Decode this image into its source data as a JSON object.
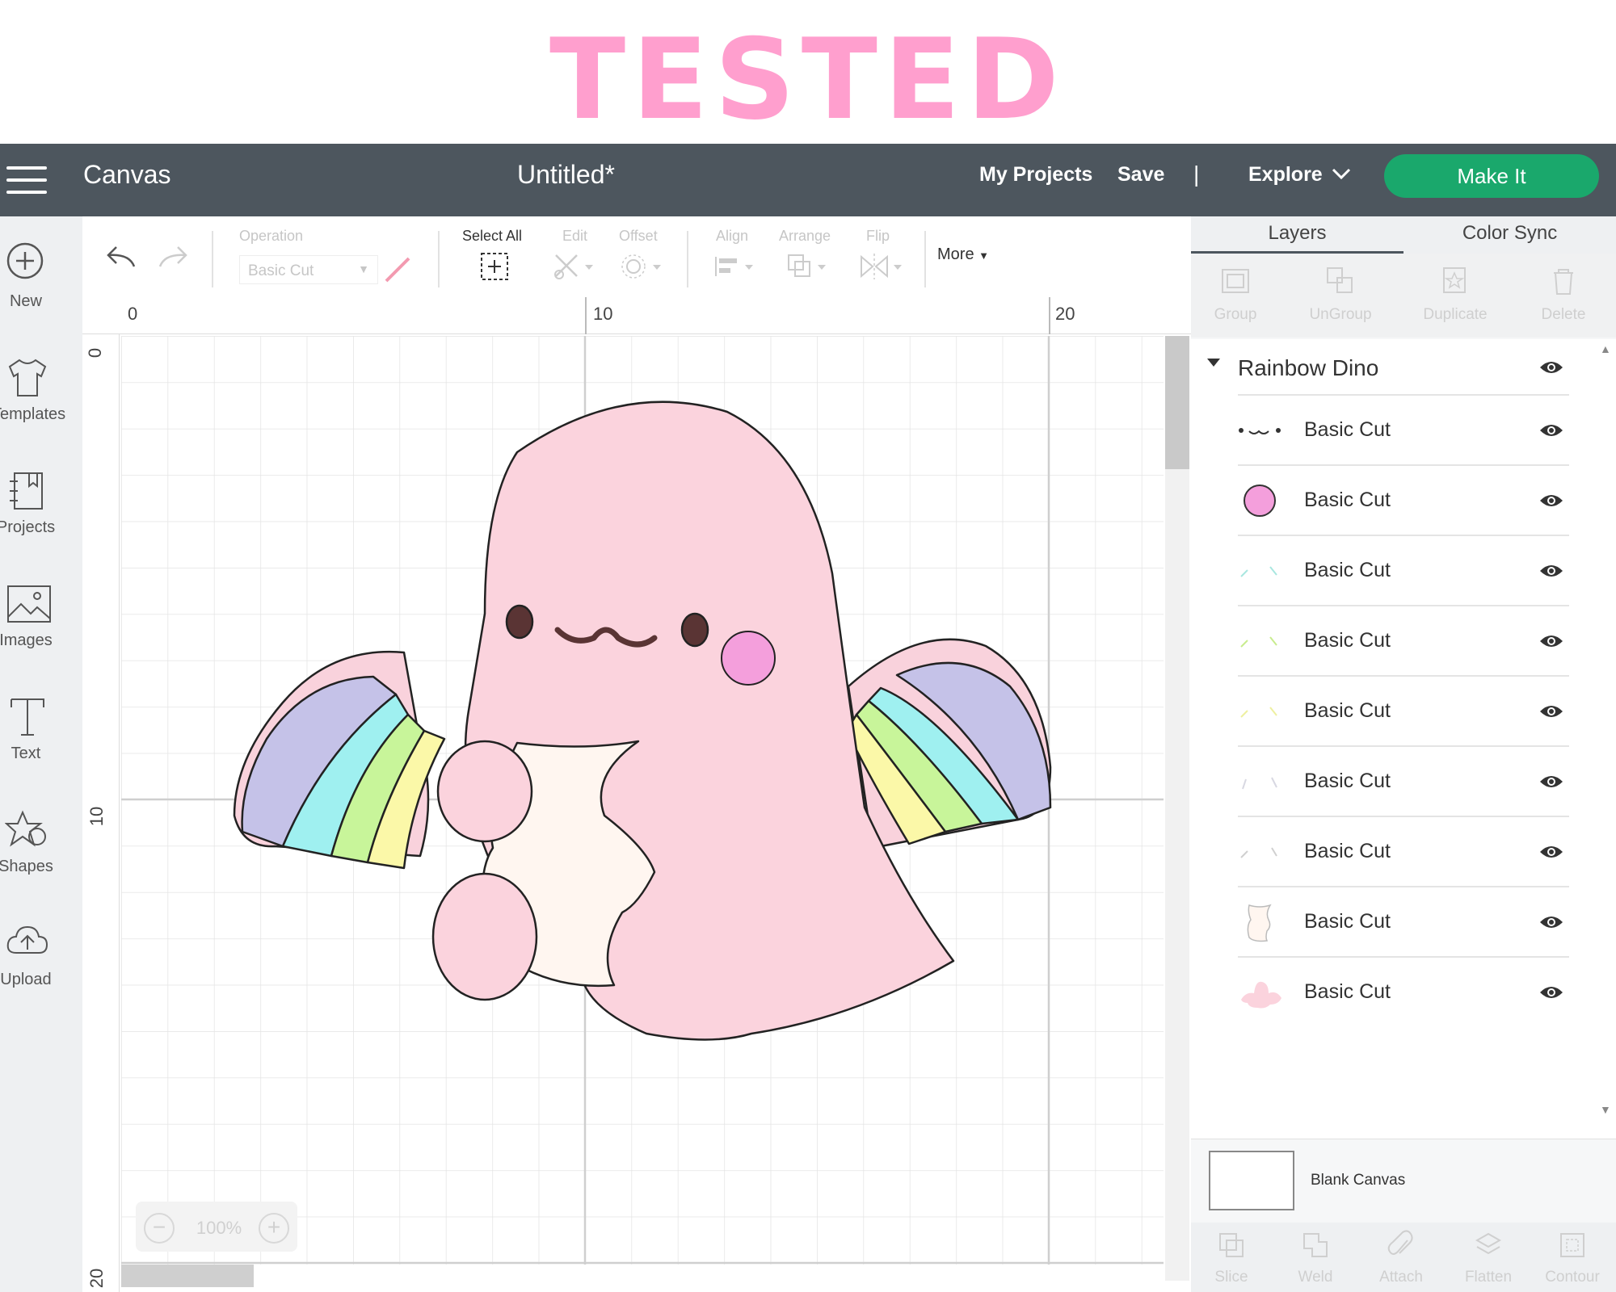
{
  "banner": {
    "title": "TESTED"
  },
  "topbar": {
    "app_name": "Canvas",
    "doc_title": "Untitled*",
    "my_projects": "My Projects",
    "save": "Save",
    "separator": "|",
    "explore": "Explore",
    "make_it": "Make It"
  },
  "sidebar": {
    "items": [
      {
        "label": "New",
        "icon": "plus-circle-icon"
      },
      {
        "label": "Templates",
        "icon": "tshirt-icon"
      },
      {
        "label": "Projects",
        "icon": "notebook-icon"
      },
      {
        "label": "Images",
        "icon": "image-icon"
      },
      {
        "label": "Text",
        "icon": "text-icon"
      },
      {
        "label": "Shapes",
        "icon": "shapes-icon"
      },
      {
        "label": "Upload",
        "icon": "upload-cloud-icon"
      }
    ]
  },
  "toolbar": {
    "operation_label": "Operation",
    "operation_value": "Basic Cut",
    "select_all": "Select All",
    "edit": "Edit",
    "offset": "Offset",
    "align": "Align",
    "arrange": "Arrange",
    "flip": "Flip",
    "more": "More"
  },
  "canvas": {
    "ruler_top": [
      "0",
      "10",
      "20"
    ],
    "ruler_left": [
      "0",
      "10",
      "20"
    ],
    "zoom_level": "100%",
    "zoom_minus": "−",
    "zoom_plus": "+"
  },
  "panel": {
    "tabs": [
      "Layers",
      "Color Sync"
    ],
    "actions": [
      "Group",
      "UnGroup",
      "Duplicate",
      "Delete"
    ],
    "group_name": "Rainbow Dino",
    "layers": [
      {
        "name": "Basic Cut",
        "thumb": "face-lines"
      },
      {
        "name": "Basic Cut",
        "thumb": "pink-circle"
      },
      {
        "name": "Basic Cut",
        "thumb": "green-strokes"
      },
      {
        "name": "Basic Cut",
        "thumb": "lime-strokes"
      },
      {
        "name": "Basic Cut",
        "thumb": "yellow-strokes"
      },
      {
        "name": "Basic Cut",
        "thumb": "gray-strokes"
      },
      {
        "name": "Basic Cut",
        "thumb": "gray-strokes"
      },
      {
        "name": "Basic Cut",
        "thumb": "belly-shape"
      },
      {
        "name": "Basic Cut",
        "thumb": "dino-body"
      }
    ],
    "blank_canvas": "Blank Canvas",
    "bottom_actions": [
      "Slice",
      "Weld",
      "Attach",
      "Flatten",
      "Contour"
    ]
  },
  "colors": {
    "accent": "#1aa86c",
    "banner": "#ff9fce",
    "topbar": "#4d565e",
    "dino_pink": "#fbd3dd"
  }
}
